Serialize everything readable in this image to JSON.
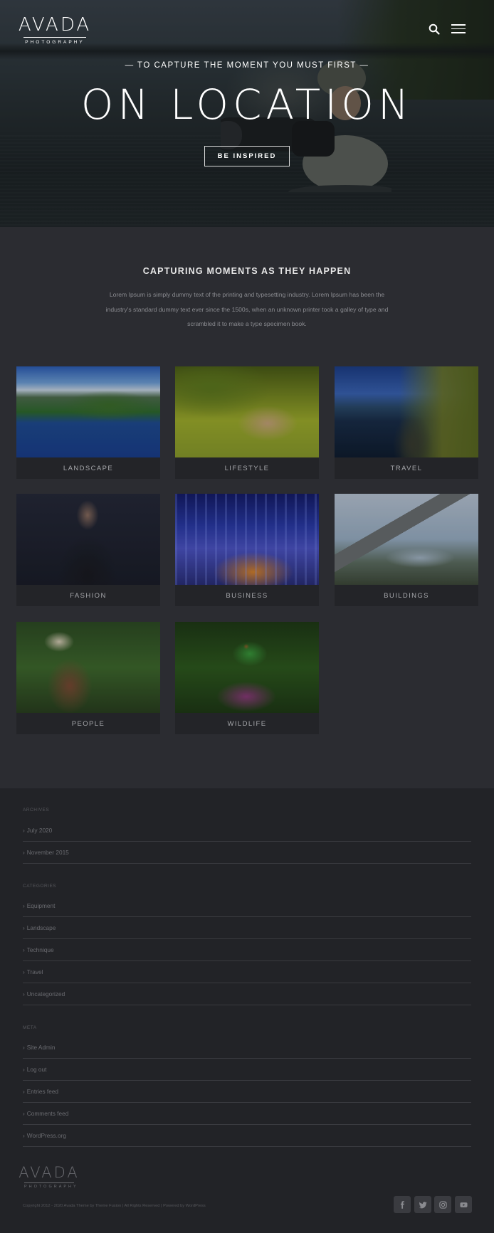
{
  "header": {
    "logo_main": "AVADA",
    "logo_sub": "PHOTOGRAPHY",
    "icons": [
      "search-icon",
      "hamburger-menu-icon"
    ]
  },
  "hero": {
    "tagline": "— TO CAPTURE THE MOMENT YOU MUST FIRST —",
    "title": "ON LOCATION",
    "button_label": "BE INSPIRED"
  },
  "intro": {
    "title": "CAPTURING MOMENTS AS THEY HAPPEN",
    "text": "Lorem Ipsum is simply dummy text of the printing and typesetting industry. Lorem Ipsum has been the industry's standard dummy text ever since the 1500s, when an unknown printer took a galley of type and scrambled it to make a type specimen book."
  },
  "categories": [
    {
      "label": "LANDSCAPE"
    },
    {
      "label": "LIFESTYLE"
    },
    {
      "label": "TRAVEL"
    },
    {
      "label": "FASHION"
    },
    {
      "label": "BUSINESS"
    },
    {
      "label": "BUILDINGS"
    },
    {
      "label": "PEOPLE"
    },
    {
      "label": "WILDLIFE"
    }
  ],
  "footer": {
    "archives": {
      "title": "ARCHIVES",
      "items": [
        "July 2020",
        "November 2015"
      ]
    },
    "categories": {
      "title": "CATEGORIES",
      "items": [
        "Equipment",
        "Landscape",
        "Technique",
        "Travel",
        "Uncategorized"
      ]
    },
    "meta": {
      "title": "META",
      "items": [
        "Site Admin",
        "Log out",
        "Entries feed",
        "Comments feed",
        "WordPress.org"
      ]
    },
    "logo_main": "AVADA",
    "logo_sub": "PHOTOGRAPHY",
    "copyright": "Copyright 2012 - 2020 Avada Theme by Theme Fusion   |   All Rights Reserved   |   Powered by WordPress",
    "social": [
      "facebook-icon",
      "twitter-icon",
      "instagram-icon",
      "youtube-icon"
    ]
  },
  "colors": {
    "page_bg": "#2b2c31",
    "footer_bg": "#222327",
    "text_light": "#e8e8e8",
    "text_muted": "#8a8b90"
  }
}
